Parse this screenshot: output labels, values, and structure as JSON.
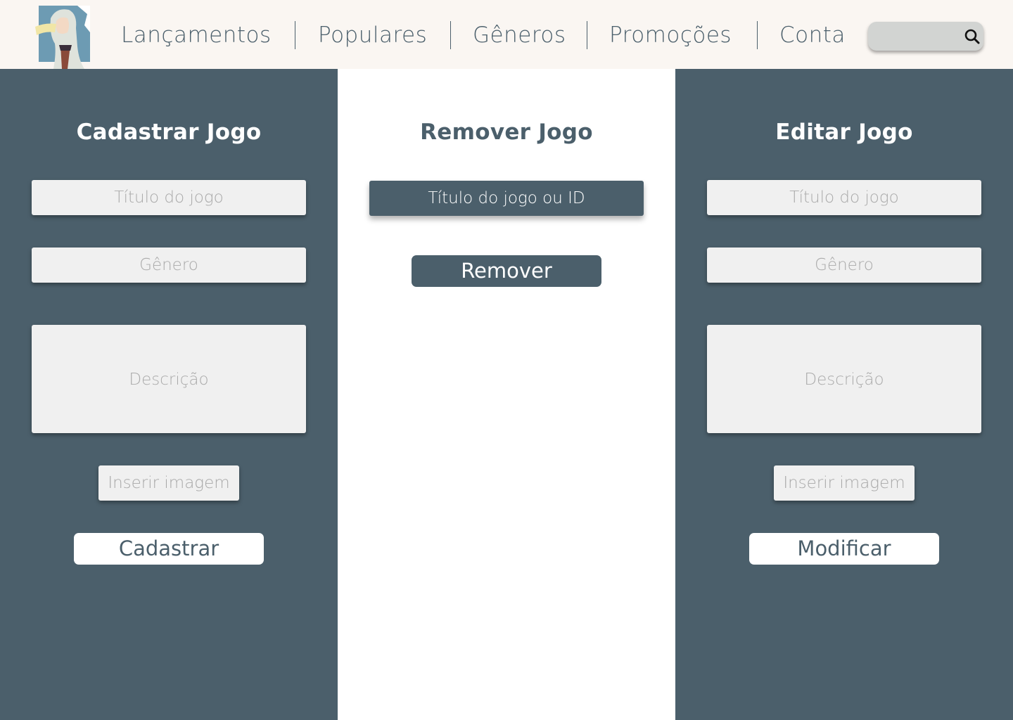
{
  "header": {
    "nav": [
      {
        "label": "Lançamentos"
      },
      {
        "label": "Populares"
      },
      {
        "label": "Gêneros"
      },
      {
        "label": "Promoções"
      },
      {
        "label": "Conta"
      }
    ],
    "search": {
      "value": "",
      "placeholder": ""
    }
  },
  "panels": {
    "register": {
      "title": "Cadastrar Jogo",
      "title_placeholder": "Título do jogo",
      "genre_placeholder": "Gênero",
      "description_placeholder": "Descrição",
      "image_button": "Inserir imagem",
      "submit": "Cadastrar"
    },
    "remove": {
      "title": "Remover Jogo",
      "id_placeholder": "Título do jogo ou ID",
      "submit": "Remover"
    },
    "edit": {
      "title": "Editar Jogo",
      "title_placeholder": "Título do jogo",
      "genre_placeholder": "Gênero",
      "description_placeholder": "Descrição",
      "image_button": "Inserir imagem",
      "submit": "Modificar"
    }
  },
  "colors": {
    "primary": "#4b5f6b",
    "header_bg": "#faf6f2",
    "field_bg": "#f0f0f0",
    "search_bg": "#d2d4d2"
  }
}
